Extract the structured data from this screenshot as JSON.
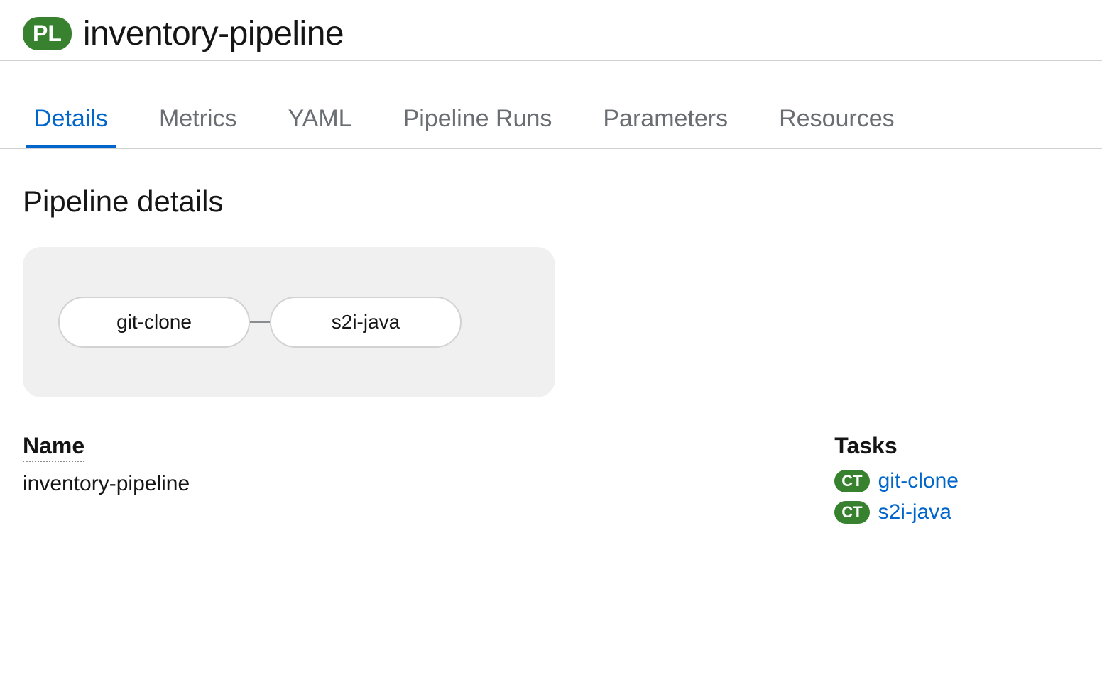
{
  "header": {
    "badge": "PL",
    "title": "inventory-pipeline"
  },
  "tabs": [
    {
      "label": "Details",
      "active": true
    },
    {
      "label": "Metrics",
      "active": false
    },
    {
      "label": "YAML",
      "active": false
    },
    {
      "label": "Pipeline Runs",
      "active": false
    },
    {
      "label": "Parameters",
      "active": false
    },
    {
      "label": "Resources",
      "active": false
    }
  ],
  "section": {
    "title": "Pipeline details"
  },
  "pipeline": {
    "nodes": [
      {
        "label": "git-clone"
      },
      {
        "label": "s2i-java"
      }
    ]
  },
  "details": {
    "name_label": "Name",
    "name_value": "inventory-pipeline",
    "tasks_label": "Tasks",
    "tasks": [
      {
        "badge": "CT",
        "label": "git-clone"
      },
      {
        "badge": "CT",
        "label": "s2i-java"
      }
    ]
  }
}
